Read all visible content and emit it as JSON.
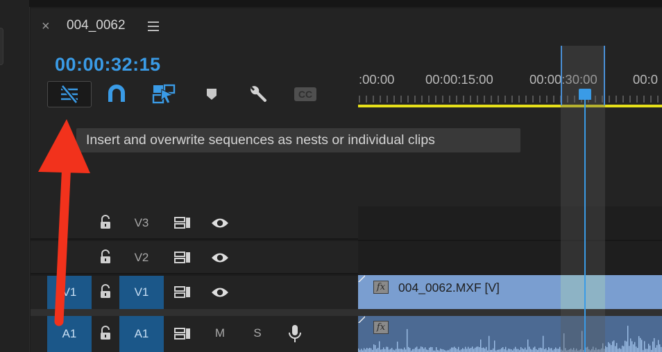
{
  "panel": {
    "close_glyph": "×",
    "sequence_name": "004_0062",
    "menu_icon": "hamburger-menu-icon",
    "timecode": "00:00:32:15"
  },
  "toolbar": {
    "tools": [
      {
        "name": "insert-overwrite-nest-toggle",
        "icon": "nest-sequence-icon",
        "active": true
      },
      {
        "name": "snap",
        "icon": "magnet-icon"
      },
      {
        "name": "linked-selection",
        "icon": "linked-selection-icon"
      },
      {
        "name": "add-marker",
        "icon": "marker-icon"
      },
      {
        "name": "timeline-settings",
        "icon": "wrench-icon"
      },
      {
        "name": "captions",
        "icon": "cc-icon",
        "label": "CC"
      }
    ]
  },
  "tooltip": {
    "text": "Insert and overwrite sequences as nests or individual clips"
  },
  "ruler": {
    "labels": [
      ":00:00",
      "00:00:15:00",
      "00:00:30:00",
      "00:0"
    ]
  },
  "tracks": [
    {
      "id": "V3",
      "label": "V3",
      "targeted": false,
      "toggle": "eye-icon"
    },
    {
      "id": "V2",
      "label": "V2",
      "targeted": false,
      "toggle": "eye-icon"
    },
    {
      "id": "V1",
      "label": "V1",
      "source_patch": "V1",
      "targeted": true,
      "toggle": "eye-icon"
    },
    {
      "id": "A1",
      "label": "A1",
      "source_patch": "A1",
      "targeted": true,
      "mute": "M",
      "solo": "S",
      "toggle": "microphone-icon"
    }
  ],
  "clips": {
    "video": {
      "name": "004_0062.MXF [V]",
      "fx_badge": "fx"
    },
    "audio": {
      "fx_badge": "fx"
    }
  },
  "colors": {
    "timecode": "#3a9be6",
    "playhead": "#3a9be6",
    "work_area_bar": "#e6e01a",
    "video_clip": "#7a9ed0",
    "audio_clip": "#4c6a93",
    "annotation_arrow": "#f2321c"
  }
}
